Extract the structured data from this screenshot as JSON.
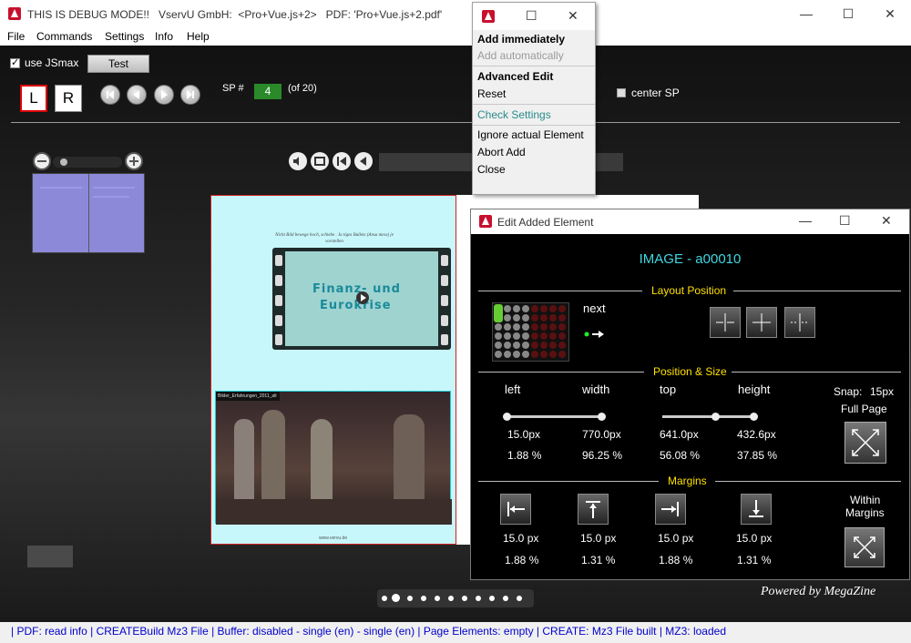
{
  "window": {
    "title": "THIS IS DEBUG MODE!!   VservU GmbH:  <Pro+Vue.js+2>   PDF: 'Pro+Vue.js+2.pdf'",
    "minimize": "—",
    "maximize": "☐",
    "close": "✕"
  },
  "menu": {
    "items": [
      "File",
      "Commands",
      "Settings",
      "Info",
      "Help"
    ]
  },
  "toolbar": {
    "use_jsmax_label": "use JSmax",
    "use_jsmax_checked": true,
    "test_label": "Test",
    "l_label": "L",
    "r_label": "R",
    "sp_label": "SP #",
    "sp_value": "4",
    "sp_of": "(of 20)",
    "center_sp_label": "center SP",
    "page_counter": "4 (20)"
  },
  "popup": {
    "add_immediately": "Add immediately",
    "add_automatically": "Add automatically",
    "advanced_edit": "Advanced Edit",
    "reset": "Reset",
    "check_settings": "Check Settings",
    "ignore_actual": "Ignore actual Element",
    "abort_add": "Abort Add",
    "close": "Close"
  },
  "edit": {
    "title": "Edit Added Element",
    "element": "IMAGE - a00010",
    "layout_position": "Layout Position",
    "next": "next",
    "position_size": "Position & Size",
    "snap": "Snap:",
    "snap_value": "15px",
    "full_page": "Full Page",
    "cols": {
      "left": {
        "label": "left",
        "px": "15.0px",
        "pct": "1.88 %"
      },
      "width": {
        "label": "width",
        "px": "770.0px",
        "pct": "96.25 %"
      },
      "top": {
        "label": "top",
        "px": "641.0px",
        "pct": "56.08 %"
      },
      "height": {
        "label": "height",
        "px": "432.6px",
        "pct": "37.85 %"
      }
    },
    "margins": "Margins",
    "within_margins_1": "Within",
    "within_margins_2": "Margins",
    "margin_vals": [
      {
        "px": "15.0 px",
        "pct": "1.88 %"
      },
      {
        "px": "15.0 px",
        "pct": "1.31 %"
      },
      {
        "px": "15.0 px",
        "pct": "1.88 %"
      },
      {
        "px": "15.0 px",
        "pct": "1.31 %"
      }
    ]
  },
  "page": {
    "text_top": "Nicht Bild bewege hoch, schiebe . Ja tiges Bullets (Ansa mess) je vorstellen",
    "video_text_1": "Finanz- und",
    "video_text_2": "Eurokrise",
    "photo_caption": "Bilder_Erfahrungen_2011_alt",
    "footer": "www.vervu.de"
  },
  "powered": "Powered by MegaZine",
  "status": "| PDF: read info | CREATEBuild Mz3 File | Buffer: disabled - single (en) - single (en) | Page Elements: empty | CREATE: Mz3 File built | MZ3: loaded",
  "colors": {
    "accent_red": "#c8102e",
    "green_sp": "#2a8a2a",
    "cyan_title": "#3fd6e0",
    "yellow_section": "#ffe000",
    "status_blue": "#0000cc"
  }
}
